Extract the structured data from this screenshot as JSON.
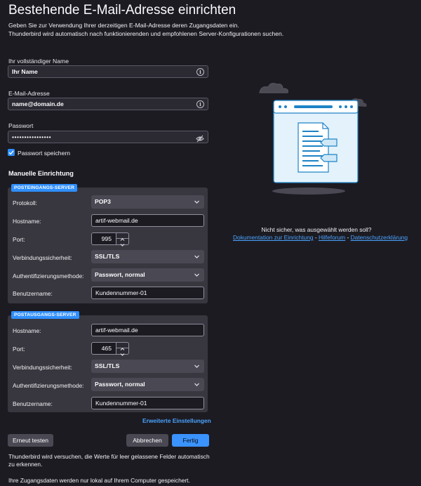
{
  "page": {
    "title": "Bestehende E-Mail-Adresse einrichten",
    "intro_line1": "Geben Sie zur Verwendung Ihrer derzeitigen E-Mail-Adresse deren Zugangsdaten ein.",
    "intro_line2": "Thunderbird wird automatisch nach funktionierenden und empfohlenen Server-Konfigurationen suchen."
  },
  "form": {
    "name_label": "Ihr vollständiger Name",
    "name_value": "Ihr Name",
    "email_label": "E-Mail-Adresse",
    "email_value": "name@domain.de",
    "password_label": "Passwort",
    "password_value": "••••••••••••••••",
    "remember_label": "Passwort speichern",
    "remember_checked": true
  },
  "manual": {
    "heading": "Manuelle Einrichtung",
    "incoming": {
      "badge": "POSTEINGANGS-SERVER",
      "protocol_label": "Protokoll:",
      "protocol_value": "POP3",
      "hostname_label": "Hostname:",
      "hostname_value": "artif-webmail.de",
      "port_label": "Port:",
      "port_value": "995",
      "security_label": "Verbindungssicherheit:",
      "security_value": "SSL/TLS",
      "auth_label": "Authentifizierungsmethode:",
      "auth_value": "Passwort, normal",
      "username_label": "Benutzername:",
      "username_value": "Kundennummer-01"
    },
    "outgoing": {
      "badge": "POSTAUSGANGS-SERVER",
      "hostname_label": "Hostname:",
      "hostname_value": "artif-webmail.de",
      "port_label": "Port:",
      "port_value": "465",
      "security_label": "Verbindungssicherheit:",
      "security_value": "SSL/TLS",
      "auth_label": "Authentifizierungsmethode:",
      "auth_value": "Passwort, normal",
      "username_label": "Benutzername:",
      "username_value": "Kundennummer-01"
    },
    "advanced_link": "Erweiterte Einstellungen"
  },
  "buttons": {
    "retest": "Erneut testen",
    "cancel": "Abbrechen",
    "done": "Fertig"
  },
  "notes": {
    "autofill_line1": "Thunderbird wird versuchen, die Werte für leer gelassene Felder automatisch",
    "autofill_line2": "zu erkennen.",
    "local": "Ihre Zugangsdaten werden nur lokal auf Ihrem Computer gespeichert."
  },
  "help": {
    "question": "Nicht sicher, was ausgewählt werden soll?",
    "link_docs": "Dokumentation zur Einrichtung",
    "sep1": " - ",
    "link_forum": "Hilfeforum",
    "sep2": " - ",
    "link_privacy": "Datenschutzerklärung"
  },
  "colors": {
    "background": "#1c1b22",
    "accent": "#3a93ff",
    "panel": "#38373f"
  }
}
